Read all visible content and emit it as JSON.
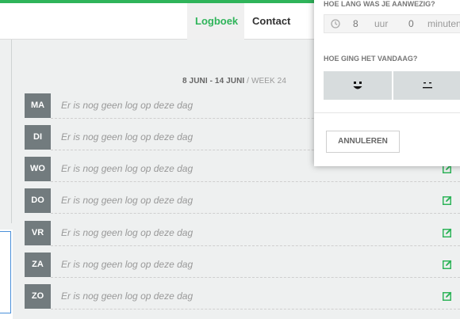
{
  "nav": {
    "items": [
      {
        "label": "Logboek",
        "active": true
      },
      {
        "label": "Contact",
        "active": false
      }
    ]
  },
  "week": {
    "range": "8 JUNI - 14 JUNI",
    "separator": " / ",
    "week_label": "WEEK 24"
  },
  "days": [
    {
      "abbr": "MA",
      "text": "Er is nog geen log op deze dag"
    },
    {
      "abbr": "DI",
      "text": "Er is nog geen log op deze dag"
    },
    {
      "abbr": "WO",
      "text": "Er is nog geen log op deze dag"
    },
    {
      "abbr": "DO",
      "text": "Er is nog geen log op deze dag"
    },
    {
      "abbr": "VR",
      "text": "Er is nog geen log op deze dag"
    },
    {
      "abbr": "ZA",
      "text": "Er is nog geen log op deze dag"
    },
    {
      "abbr": "ZO",
      "text": "Er is nog geen log op deze dag"
    }
  ],
  "modal": {
    "duration_question": "HOE LANG WAS JE AANWEZIG?",
    "hours": "8",
    "hours_unit": "uur",
    "minutes": "0",
    "minutes_unit": "minuten",
    "mood_question": "HOE GING HET VANDAAG?",
    "cancel_label": "ANNULEREN"
  },
  "colors": {
    "accent": "#2fb45a",
    "day_badge": "#727b7e",
    "mood_button": "#d7dcdd"
  },
  "icons": {
    "edit": "edit-icon",
    "clock": "clock-icon",
    "mood_happy": "happy-face-icon",
    "mood_neutral": "neutral-face-icon"
  }
}
